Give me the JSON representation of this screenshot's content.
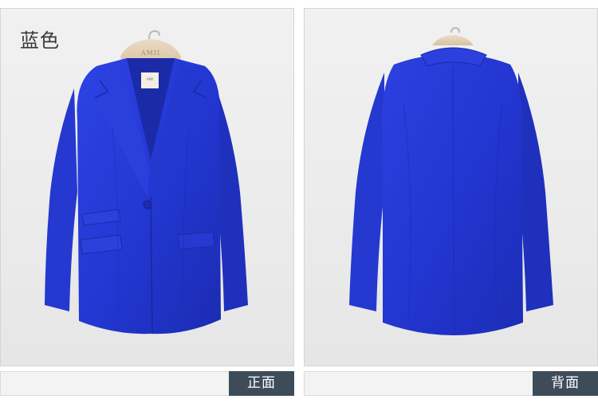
{
  "color_name": "蓝色",
  "views": {
    "front_label": "正面",
    "back_label": "背面"
  },
  "hanger_brand": "AMII",
  "colors": {
    "jacket_blue": "#2437d6",
    "label_bg": "#3e4c5a",
    "panel_bg": "#ebebeb"
  }
}
